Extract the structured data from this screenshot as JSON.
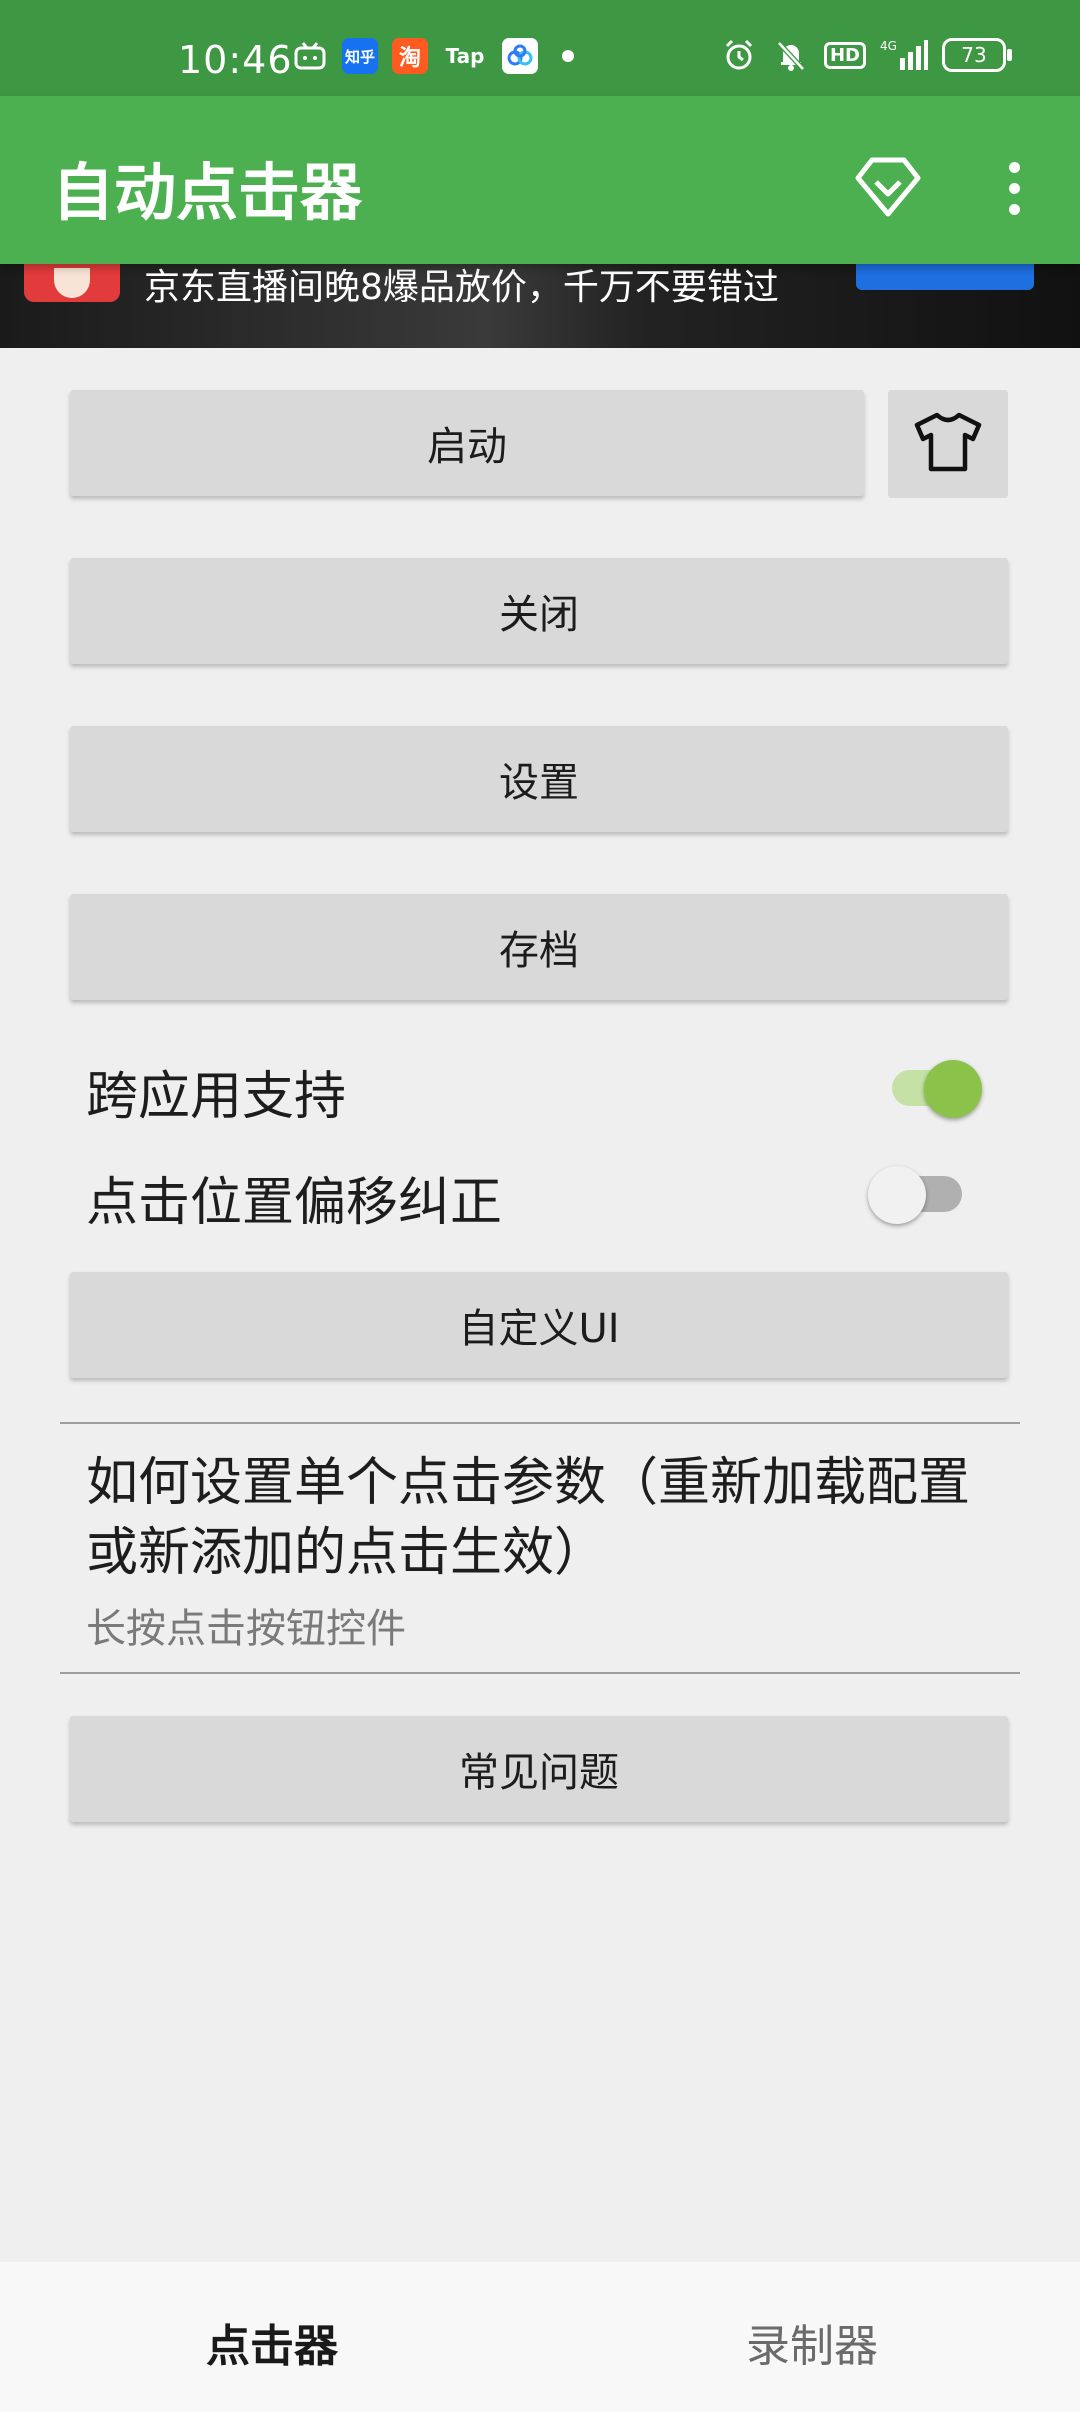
{
  "status_bar": {
    "time": "10:46",
    "app_icons": [
      {
        "name": "bilibili-icon",
        "label": "",
        "color": "#3e9743"
      },
      {
        "name": "zhihu-icon",
        "label": "知乎",
        "color": "#1672f0"
      },
      {
        "name": "taobao-icon",
        "label": "淘",
        "color": "#ff5a1f"
      },
      {
        "name": "taptap-icon",
        "label": "Tap",
        "color": "#3e9743"
      },
      {
        "name": "baidu-netdisk-icon",
        "label": "",
        "color": "#ffffff"
      }
    ],
    "hd": "HD",
    "network": "4G",
    "battery": "73"
  },
  "app_bar": {
    "title": "自动点击器"
  },
  "ad": {
    "text": "京东直播间晚8爆品放价，千万不要错过"
  },
  "buttons": {
    "start": "启动",
    "close": "关闭",
    "settings": "设置",
    "archive": "存档",
    "custom_ui": "自定义UI",
    "faq": "常见问题"
  },
  "switches": {
    "cross_app": {
      "label": "跨应用支持",
      "on": true
    },
    "offset_correction": {
      "label": "点击位置偏移纠正",
      "on": false
    }
  },
  "help": {
    "title": "如何设置单个点击参数（重新加载配置或新添加的点击生效）",
    "subtitle": "长按点击按钮控件"
  },
  "bottom_nav": {
    "tabs": [
      {
        "label": "点击器",
        "active": true
      },
      {
        "label": "录制器",
        "active": false
      }
    ]
  },
  "colors": {
    "status_bar": "#3e9743",
    "app_bar": "#4caf50",
    "switch_on": "#8bc34a",
    "button": "#d9d9d9"
  }
}
